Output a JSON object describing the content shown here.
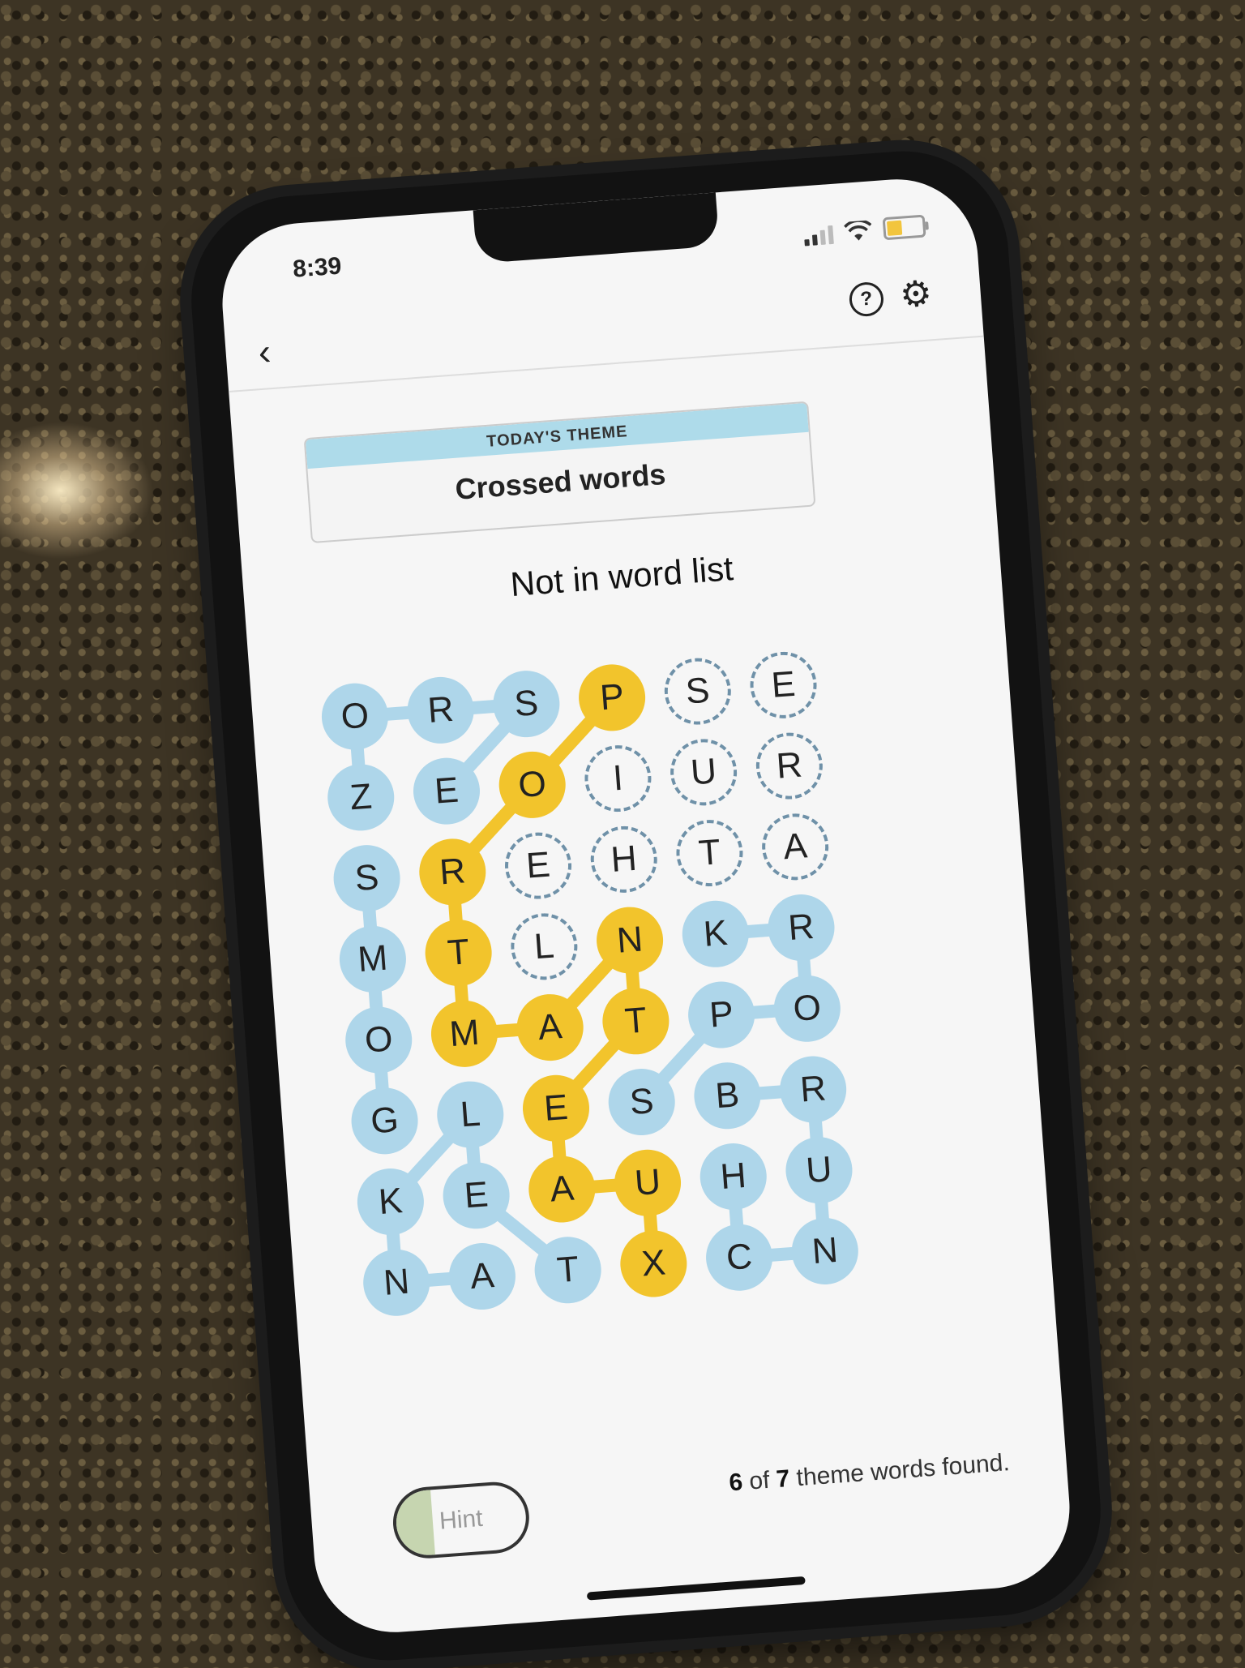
{
  "status": {
    "time": "8:39"
  },
  "theme": {
    "label": "TODAY'S THEME",
    "value": "Crossed words"
  },
  "message": "Not in word list",
  "grid": [
    [
      {
        "l": "O",
        "s": "blue"
      },
      {
        "l": "R",
        "s": "blue"
      },
      {
        "l": "S",
        "s": "blue"
      },
      {
        "l": "P",
        "s": "yellow"
      },
      {
        "l": "S",
        "s": "open"
      },
      {
        "l": "E",
        "s": "open"
      }
    ],
    [
      {
        "l": "Z",
        "s": "blue"
      },
      {
        "l": "E",
        "s": "blue"
      },
      {
        "l": "O",
        "s": "yellow"
      },
      {
        "l": "I",
        "s": "open"
      },
      {
        "l": "U",
        "s": "open"
      },
      {
        "l": "R",
        "s": "open"
      }
    ],
    [
      {
        "l": "S",
        "s": "blue"
      },
      {
        "l": "R",
        "s": "yellow"
      },
      {
        "l": "E",
        "s": "open"
      },
      {
        "l": "H",
        "s": "open"
      },
      {
        "l": "T",
        "s": "open"
      },
      {
        "l": "A",
        "s": "open"
      }
    ],
    [
      {
        "l": "M",
        "s": "blue"
      },
      {
        "l": "T",
        "s": "yellow"
      },
      {
        "l": "L",
        "s": "open"
      },
      {
        "l": "N",
        "s": "yellow"
      },
      {
        "l": "K",
        "s": "blue"
      },
      {
        "l": "R",
        "s": "blue"
      }
    ],
    [
      {
        "l": "O",
        "s": "blue"
      },
      {
        "l": "M",
        "s": "yellow"
      },
      {
        "l": "A",
        "s": "yellow"
      },
      {
        "l": "T",
        "s": "yellow"
      },
      {
        "l": "P",
        "s": "blue"
      },
      {
        "l": "O",
        "s": "blue"
      }
    ],
    [
      {
        "l": "G",
        "s": "blue"
      },
      {
        "l": "L",
        "s": "blue"
      },
      {
        "l": "E",
        "s": "yellow"
      },
      {
        "l": "S",
        "s": "blue"
      },
      {
        "l": "B",
        "s": "blue"
      },
      {
        "l": "R",
        "s": "blue"
      }
    ],
    [
      {
        "l": "K",
        "s": "blue"
      },
      {
        "l": "E",
        "s": "blue"
      },
      {
        "l": "A",
        "s": "yellow"
      },
      {
        "l": "U",
        "s": "yellow"
      },
      {
        "l": "H",
        "s": "blue"
      },
      {
        "l": "U",
        "s": "blue"
      }
    ],
    [
      {
        "l": "N",
        "s": "blue"
      },
      {
        "l": "A",
        "s": "blue"
      },
      {
        "l": "T",
        "s": "blue"
      },
      {
        "l": "X",
        "s": "yellow"
      },
      {
        "l": "C",
        "s": "blue"
      },
      {
        "l": "N",
        "s": "blue"
      }
    ]
  ],
  "found_paths": [
    {
      "color": "#aed6ea",
      "cells": [
        [
          1,
          0
        ],
        [
          0,
          0
        ],
        [
          0,
          1
        ],
        [
          0,
          2
        ],
        [
          1,
          1
        ]
      ]
    },
    {
      "color": "#f2c42c",
      "cells": [
        [
          0,
          3
        ],
        [
          1,
          2
        ],
        [
          2,
          1
        ],
        [
          3,
          1
        ],
        [
          4,
          1
        ],
        [
          4,
          2
        ],
        [
          3,
          3
        ],
        [
          4,
          3
        ],
        [
          5,
          2
        ],
        [
          6,
          2
        ],
        [
          6,
          3
        ],
        [
          7,
          3
        ]
      ]
    },
    {
      "color": "#aed6ea",
      "cells": [
        [
          2,
          0
        ],
        [
          3,
          0
        ],
        [
          4,
          0
        ],
        [
          5,
          0
        ]
      ]
    },
    {
      "color": "#aed6ea",
      "cells": [
        [
          5,
          1
        ],
        [
          6,
          0
        ],
        [
          7,
          0
        ],
        [
          7,
          1
        ]
      ]
    },
    {
      "color": "#aed6ea",
      "cells": [
        [
          5,
          1
        ],
        [
          6,
          1
        ],
        [
          7,
          2
        ]
      ]
    },
    {
      "color": "#aed6ea",
      "cells": [
        [
          3,
          4
        ],
        [
          3,
          5
        ],
        [
          4,
          5
        ],
        [
          4,
          4
        ],
        [
          5,
          3
        ]
      ]
    },
    {
      "color": "#aed6ea",
      "cells": [
        [
          5,
          4
        ],
        [
          5,
          5
        ],
        [
          6,
          5
        ],
        [
          7,
          5
        ],
        [
          7,
          4
        ],
        [
          6,
          4
        ]
      ]
    }
  ],
  "footer": {
    "hint_label": "Hint",
    "hint_progress": 0.28,
    "found": "6",
    "total": "7",
    "progress_text": "theme words found."
  }
}
